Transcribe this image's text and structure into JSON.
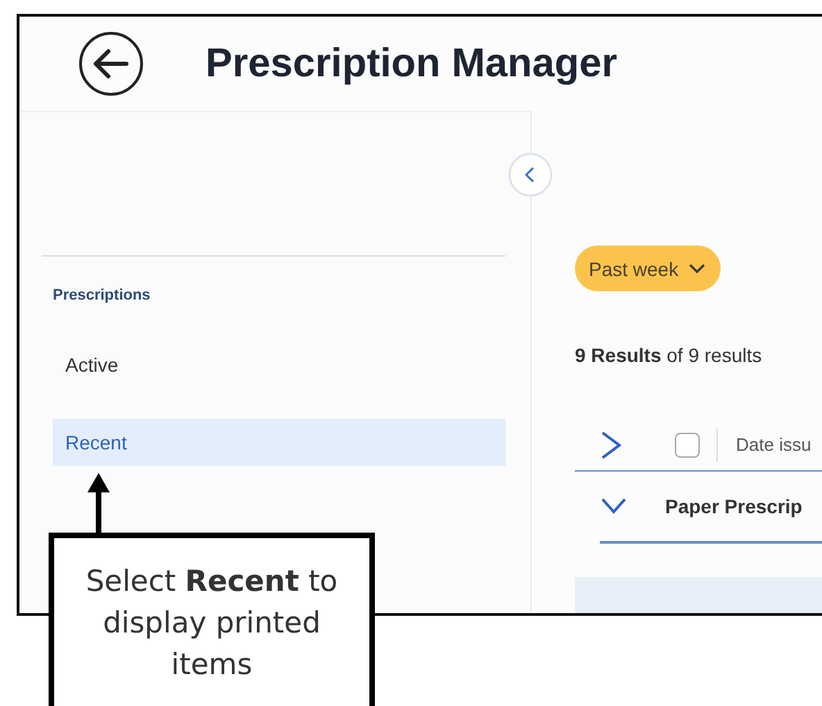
{
  "header": {
    "title": "Prescription Manager"
  },
  "sidebar": {
    "section": "Prescriptions",
    "items": [
      {
        "label": "Active",
        "selected": false
      },
      {
        "label": "Recent",
        "selected": true
      }
    ]
  },
  "filter": {
    "label": "Past week"
  },
  "results": "**9 Results** of 9 results",
  "table": {
    "header": {
      "expanded": false,
      "checked": false,
      "column_1": "Date issu"
    },
    "groups": [
      {
        "label": "Paper Prescrip",
        "expanded": true
      }
    ]
  },
  "callout": "Select **Recent** to display printed items"
}
